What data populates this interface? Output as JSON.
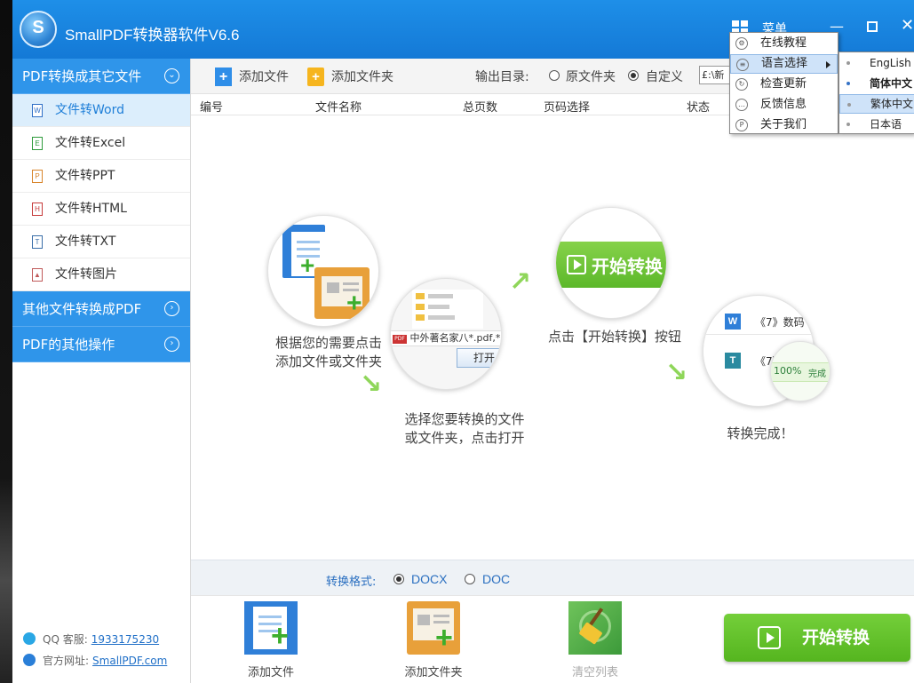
{
  "window": {
    "title": "SmallPDF转换器软件V6.6",
    "menu_label": "菜单"
  },
  "sidebar": {
    "categories": [
      {
        "label": "PDF转换成其它文件",
        "arrow": "⌄"
      },
      {
        "label": "其他文件转换成PDF",
        "arrow": "›"
      },
      {
        "label": "PDF的其他操作",
        "arrow": "›"
      }
    ],
    "items": [
      {
        "label": "文件转Word",
        "icon": "W"
      },
      {
        "label": "文件转Excel",
        "icon": "E"
      },
      {
        "label": "文件转PPT",
        "icon": "P"
      },
      {
        "label": "文件转HTML",
        "icon": "H"
      },
      {
        "label": "文件转TXT",
        "icon": "T"
      },
      {
        "label": "文件转图片",
        "icon": "▲"
      }
    ],
    "contact": {
      "qq_label": "QQ 客服:",
      "qq_number": "1933175230",
      "site_label": "官方网址:",
      "site_url": "SmallPDF.com"
    }
  },
  "toolbar": {
    "add_file": "添加文件",
    "add_folder": "添加文件夹",
    "output_label": "输出目录:",
    "option_source": "原文件夹",
    "option_custom": "自定义",
    "path_value": "£:\\新"
  },
  "table": {
    "headers": [
      "编号",
      "文件名称",
      "总页数",
      "页码选择",
      "状态"
    ]
  },
  "steps": {
    "step1": "根据您的需要点击\n添加文件或文件夹",
    "step2": "选择您要转换的文件\n或文件夹，点击打开",
    "step3": "点击【开始转换】按钮",
    "step4": "转换完成！",
    "illus_file_row": "中外著名家",
    "illus_file_ext": "八*.pdf,*.",
    "illus_open": "打开",
    "illus_start": "开始转换",
    "illus_doc1": "《7》数码",
    "illus_doc2": "《7》",
    "illus_progress": "100%",
    "illus_done": "完成"
  },
  "format": {
    "label": "转换格式:",
    "options": [
      "DOCX",
      "DOC"
    ],
    "selected": "DOCX"
  },
  "bottom": {
    "add_file": "添加文件",
    "add_folder": "添加文件夹",
    "clear_list": "清空列表",
    "start": "开始转换"
  },
  "menu": {
    "items": [
      "在线教程",
      "语言选择",
      "检查更新",
      "反馈信息",
      "关于我们"
    ],
    "languages": [
      "EngLish",
      "简体中文",
      "繁体中文",
      "日本语"
    ],
    "highlighted_item": "语言选择",
    "highlighted_language": "繁体中文",
    "current_language": "简体中文"
  },
  "colors": {
    "titlebar": "#1479d6",
    "sidebar_category": "#2f95ea",
    "accent_green": "#55b51f",
    "link_blue": "#1f6fc7"
  }
}
